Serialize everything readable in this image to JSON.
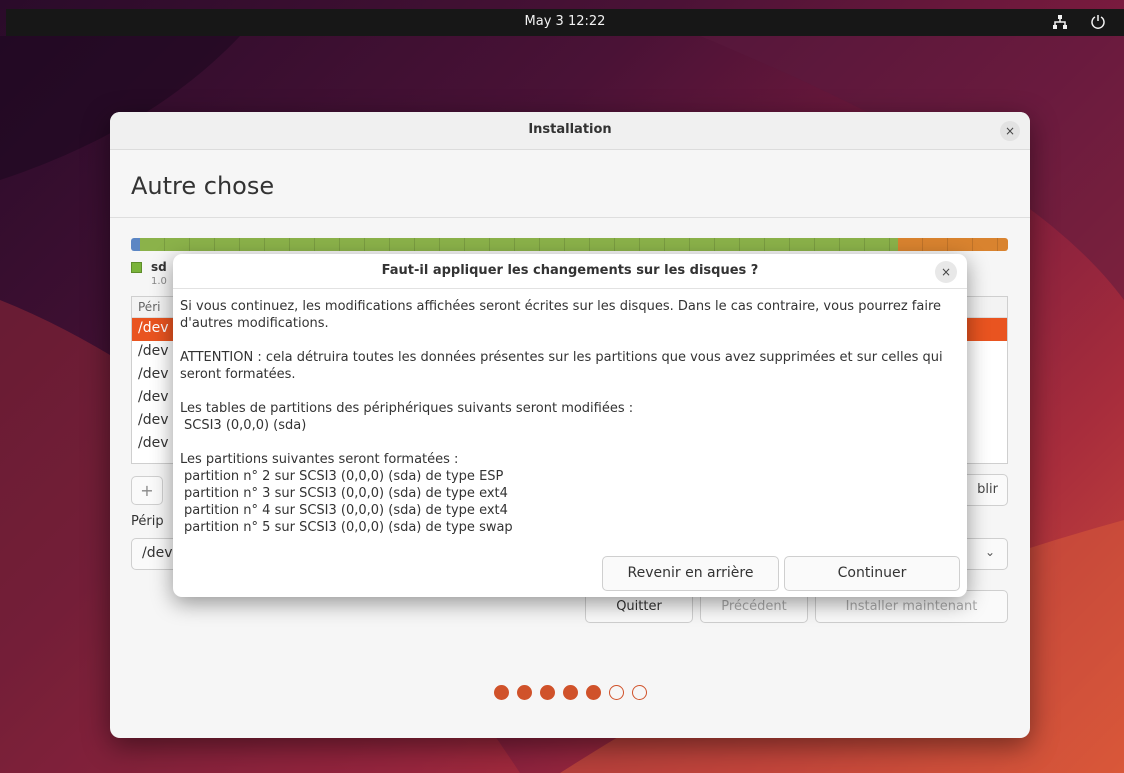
{
  "topbar": {
    "clock": "May 3  12:22",
    "network_icon": "network-icon",
    "power_icon": "power-icon"
  },
  "window": {
    "title": "Installation",
    "page_title": "Autre chose",
    "close_glyph": "×",
    "disk": {
      "name": "sd",
      "size": "1.0"
    },
    "table": {
      "header": "Péri",
      "rows": [
        "/dev",
        "/dev",
        "/dev",
        "/dev",
        "/dev",
        "/dev"
      ]
    },
    "buttons": {
      "add": "+",
      "restore": "blir",
      "quit": "Quitter",
      "previous": "Précédent",
      "install": "Installer maintenant"
    },
    "boot_label": "Périp",
    "boot_value": "/dev",
    "steps": {
      "done": 5,
      "total": 7
    }
  },
  "dialog": {
    "title": "Faut-il appliquer les changements sur les disques ?",
    "close_glyph": "×",
    "para1": "Si vous continuez, les modifications affichées seront écrites sur les disques. Dans le cas contraire, vous pourrez faire d'autres modifications.",
    "para2": "ATTENTION : cela détruira toutes les données présentes sur les partitions que vous avez supprimées et sur celles qui seront formatées.",
    "tables_heading": "Les tables de partitions des périphériques suivants seront modifiées :",
    "tables_item": "SCSI3 (0,0,0) (sda)",
    "format_heading": "Les partitions suivantes seront formatées :",
    "format_items": [
      "partition n° 2 sur SCSI3 (0,0,0) (sda) de type ESP",
      "partition n° 3 sur SCSI3 (0,0,0) (sda) de type ext4",
      "partition n° 4 sur SCSI3 (0,0,0) (sda) de type ext4",
      "partition n° 5 sur SCSI3 (0,0,0) (sda) de type swap"
    ],
    "back_label": "Revenir en arrière",
    "continue_label": "Continuer"
  },
  "colors": {
    "accent": "#E95420",
    "topbar": "#171717"
  }
}
